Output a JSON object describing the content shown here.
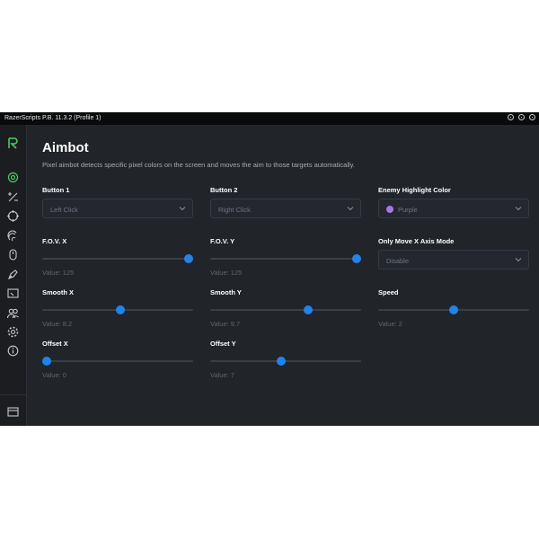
{
  "window": {
    "title": "RazerScripts P.B. 11.3.2 (Profile 1)"
  },
  "header": {
    "title": "Aimbot",
    "description": "Pixel aimbot detects specific pixel colors on the screen and moves the aim to those targets automatically."
  },
  "selects": {
    "button1": {
      "label": "Button 1",
      "value": "Left Click"
    },
    "button2": {
      "label": "Button 2",
      "value": "Right Click"
    },
    "enemy_color": {
      "label": "Enemy Highlight Color",
      "value": "Purple",
      "swatch": "#a877e6"
    },
    "only_move_x": {
      "label": "Only Move X Axis Mode",
      "value": "Disable"
    }
  },
  "sliders": {
    "fov_x": {
      "label": "F.O.V. X",
      "value_text": "Value: 125",
      "fraction": 1.0
    },
    "fov_y": {
      "label": "F.O.V. Y",
      "value_text": "Value: 125",
      "fraction": 1.0
    },
    "smooth_x": {
      "label": "Smooth X",
      "value_text": "Value: 8.2",
      "fraction": 0.52
    },
    "smooth_y": {
      "label": "Smooth Y",
      "value_text": "Value: 9.7",
      "fraction": 0.66
    },
    "speed": {
      "label": "Speed",
      "value_text": "Value: 2",
      "fraction": 0.5
    },
    "offset_x": {
      "label": "Offset X",
      "value_text": "Value: 0",
      "fraction": 0.0
    },
    "offset_y": {
      "label": "Offset Y",
      "value_text": "Value: 7",
      "fraction": 0.47
    }
  },
  "sidebar_icons": [
    "logo-icon",
    "crosshair-icon",
    "percent-icon",
    "target-icon",
    "fingerprint-icon",
    "mouse-icon",
    "pen-icon",
    "window-icon",
    "users-icon",
    "gear-icon",
    "info-icon",
    "panel-icon"
  ],
  "colors": {
    "accent": "#1d84f0",
    "brand": "#3fd160",
    "background": "#212429"
  }
}
